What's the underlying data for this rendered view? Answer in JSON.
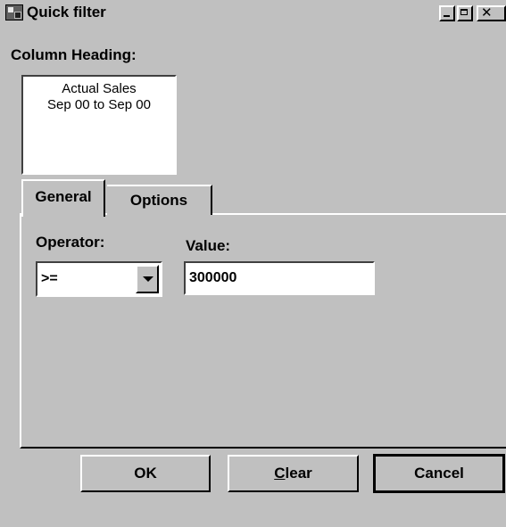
{
  "window": {
    "title": "Quick filter"
  },
  "column_heading": {
    "label": "Column Heading:",
    "lines": [
      "Actual Sales",
      "Sep 00 to Sep 00"
    ]
  },
  "tabs": [
    {
      "label": "General",
      "active": true
    },
    {
      "label": "Options",
      "active": false
    }
  ],
  "filter": {
    "operator_label": "Operator:",
    "operator_value": ">=",
    "value_label": "Value:",
    "value": "300000"
  },
  "buttons": {
    "ok": "OK",
    "clear_mnemonic": "C",
    "clear_rest": "lear",
    "cancel": "Cancel"
  },
  "colors": {
    "face": "#c0c0c0",
    "highlight": "#ffffff",
    "shadow": "#000000"
  }
}
